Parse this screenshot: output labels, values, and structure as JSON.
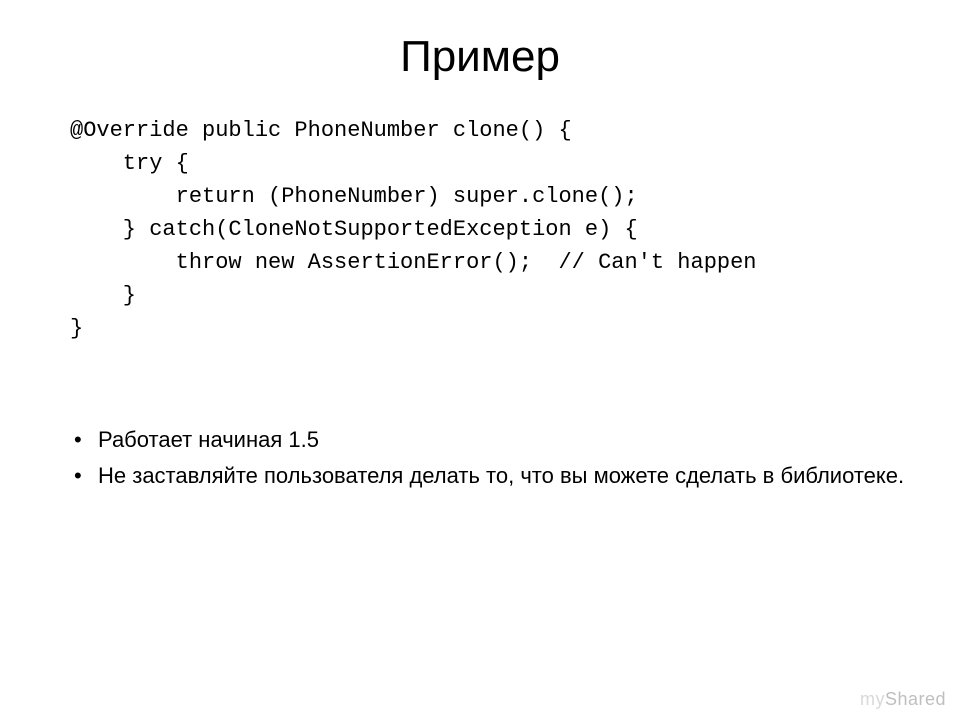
{
  "slide": {
    "title": "Пример",
    "code": {
      "l1": "@Override public PhoneNumber clone() {",
      "l2": "    try {",
      "l3": "        return (PhoneNumber) super.clone();",
      "l4": "    } catch(CloneNotSupportedException e) {",
      "l5": "        throw new AssertionError();  // Can't happen",
      "l6": "    }",
      "l7": "}"
    },
    "bullets": [
      "Работает начиная 1.5",
      "Не заставляйте пользователя делать то, что вы можете сделать в библиотеке."
    ]
  },
  "watermark": {
    "my": "my",
    "shared": "Shared"
  }
}
